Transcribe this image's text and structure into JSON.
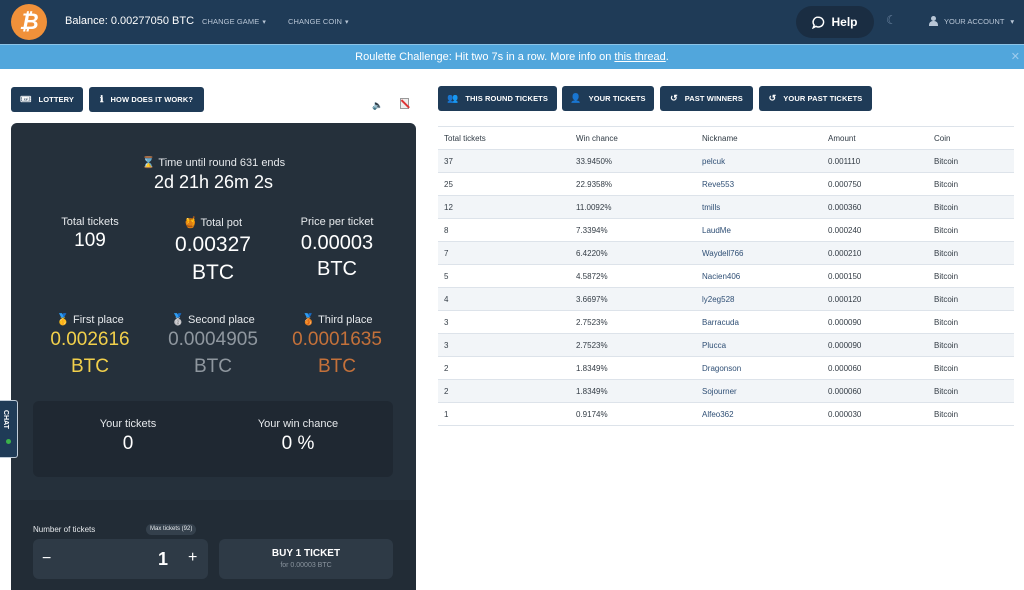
{
  "topbar": {
    "logo_glyph": "₿",
    "balance": "Balance: 0.00277050 BTC",
    "change_game": "CHANGE GAME",
    "change_coin": "CHANGE COIN",
    "help": "Help",
    "moon_glyph": "☾",
    "account": "YOUR ACCOUNT",
    "caret": "▾"
  },
  "announcement": {
    "text": "Roulette Challenge: Hit two 7s in a row. More info on ",
    "link": "this thread",
    "suffix": ".",
    "close": "✕"
  },
  "left_buttons": {
    "lottery": "LOTTERY",
    "how": "HOW DOES IT WORK?",
    "lottery_glyph": "🎟",
    "info_glyph": "ℹ"
  },
  "round": {
    "hourglass": "⌛",
    "label": "Time until round 631 ends",
    "countdown": "2d 21h 26m 2s"
  },
  "stats": {
    "total_tickets_label": "Total tickets",
    "total_tickets": "109",
    "pot_icon": "🍯",
    "total_pot_label": "Total pot",
    "total_pot": "0.00327",
    "total_pot_unit": "BTC",
    "price_label": "Price per ticket",
    "price": "0.00003",
    "price_unit": "BTC"
  },
  "prizes": [
    {
      "medal": "🥇",
      "label": "First place",
      "value": "0.002616",
      "unit": "BTC"
    },
    {
      "medal": "🥈",
      "label": "Second place",
      "value": "0.0004905",
      "unit": "BTC"
    },
    {
      "medal": "🥉",
      "label": "Third place",
      "value": "0.0001635",
      "unit": "BTC"
    }
  ],
  "yours": {
    "tickets_label": "Your tickets",
    "tickets": "0",
    "chance_label": "Your win chance",
    "chance": "0 %"
  },
  "buy": {
    "number_label": "Number of tickets",
    "max_badge": "Max tickets (92)",
    "minus": "−",
    "qty": "1",
    "plus": "+",
    "button": "BUY 1 TICKET",
    "sub": "for 0.00003 BTC"
  },
  "chat": {
    "label": "CHAT"
  },
  "right_tabs": [
    {
      "label": "THIS ROUND TICKETS",
      "icon": "👥"
    },
    {
      "label": "YOUR TICKETS",
      "icon": "👤"
    },
    {
      "label": "PAST WINNERS",
      "icon": "↺"
    },
    {
      "label": "YOUR PAST TICKETS",
      "icon": "↺"
    }
  ],
  "table": {
    "headers": [
      "Total tickets",
      "Win chance",
      "Nickname",
      "Amount",
      "Coin"
    ],
    "rows": [
      [
        "37",
        "33.9450%",
        "pelcuk",
        "0.001110",
        "Bitcoin"
      ],
      [
        "25",
        "22.9358%",
        "Reve553",
        "0.000750",
        "Bitcoin"
      ],
      [
        "12",
        "11.0092%",
        "tmills",
        "0.000360",
        "Bitcoin"
      ],
      [
        "8",
        "7.3394%",
        "LaudMe",
        "0.000240",
        "Bitcoin"
      ],
      [
        "7",
        "6.4220%",
        "Waydell766",
        "0.000210",
        "Bitcoin"
      ],
      [
        "5",
        "4.5872%",
        "Nacien406",
        "0.000150",
        "Bitcoin"
      ],
      [
        "4",
        "3.6697%",
        "ly2eg528",
        "0.000120",
        "Bitcoin"
      ],
      [
        "3",
        "2.7523%",
        "Barracuda",
        "0.000090",
        "Bitcoin"
      ],
      [
        "3",
        "2.7523%",
        "Plucca",
        "0.000090",
        "Bitcoin"
      ],
      [
        "2",
        "1.8349%",
        "Dragonson",
        "0.000060",
        "Bitcoin"
      ],
      [
        "2",
        "1.8349%",
        "Sojourner",
        "0.000060",
        "Bitcoin"
      ],
      [
        "1",
        "0.9174%",
        "Alfeo362",
        "0.000030",
        "Bitcoin"
      ]
    ]
  }
}
